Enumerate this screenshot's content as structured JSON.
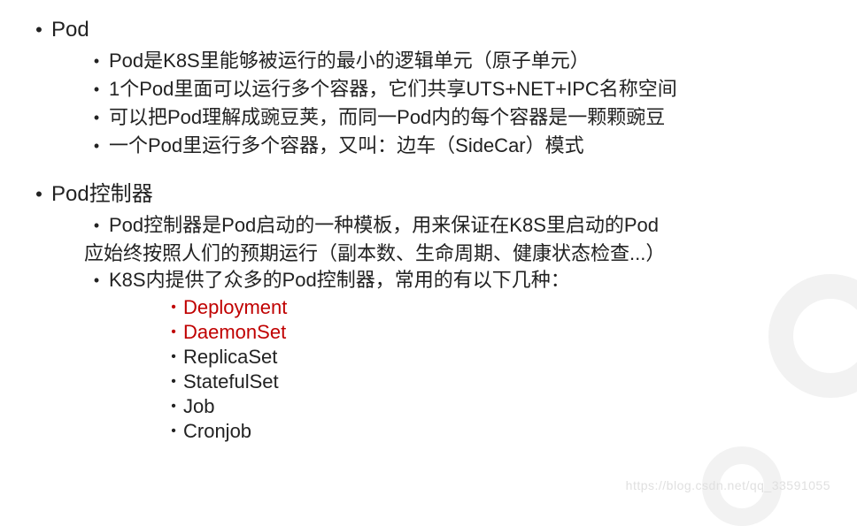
{
  "sections": [
    {
      "title": "Pod",
      "items": [
        "Pod是K8S里能够被运行的最小的逻辑单元（原子单元）",
        "1个Pod里面可以运行多个容器，它们共享UTS+NET+IPC名称空间",
        "可以把Pod理解成豌豆荚，而同一Pod内的每个容器是一颗颗豌豆",
        "一个Pod里运行多个容器，又叫：边车（SideCar）模式"
      ]
    },
    {
      "title": "Pod控制器",
      "items": [
        {
          "line1": "Pod控制器是Pod启动的一种模板，用来保证在K8S里启动的Pod",
          "line2": "应始终按照人们的预期运行（副本数、生命周期、健康状态检查...）"
        },
        "K8S内提供了众多的Pod控制器，常用的有以下几种："
      ],
      "subitems": [
        {
          "text": "Deployment",
          "color": "red"
        },
        {
          "text": "DaemonSet",
          "color": "red"
        },
        {
          "text": "ReplicaSet",
          "color": "black"
        },
        {
          "text": "StatefulSet",
          "color": "black"
        },
        {
          "text": "Job",
          "color": "black"
        },
        {
          "text": "Cronjob",
          "color": "black"
        }
      ]
    }
  ],
  "watermark": "https://blog.csdn.net/qq_33591055"
}
